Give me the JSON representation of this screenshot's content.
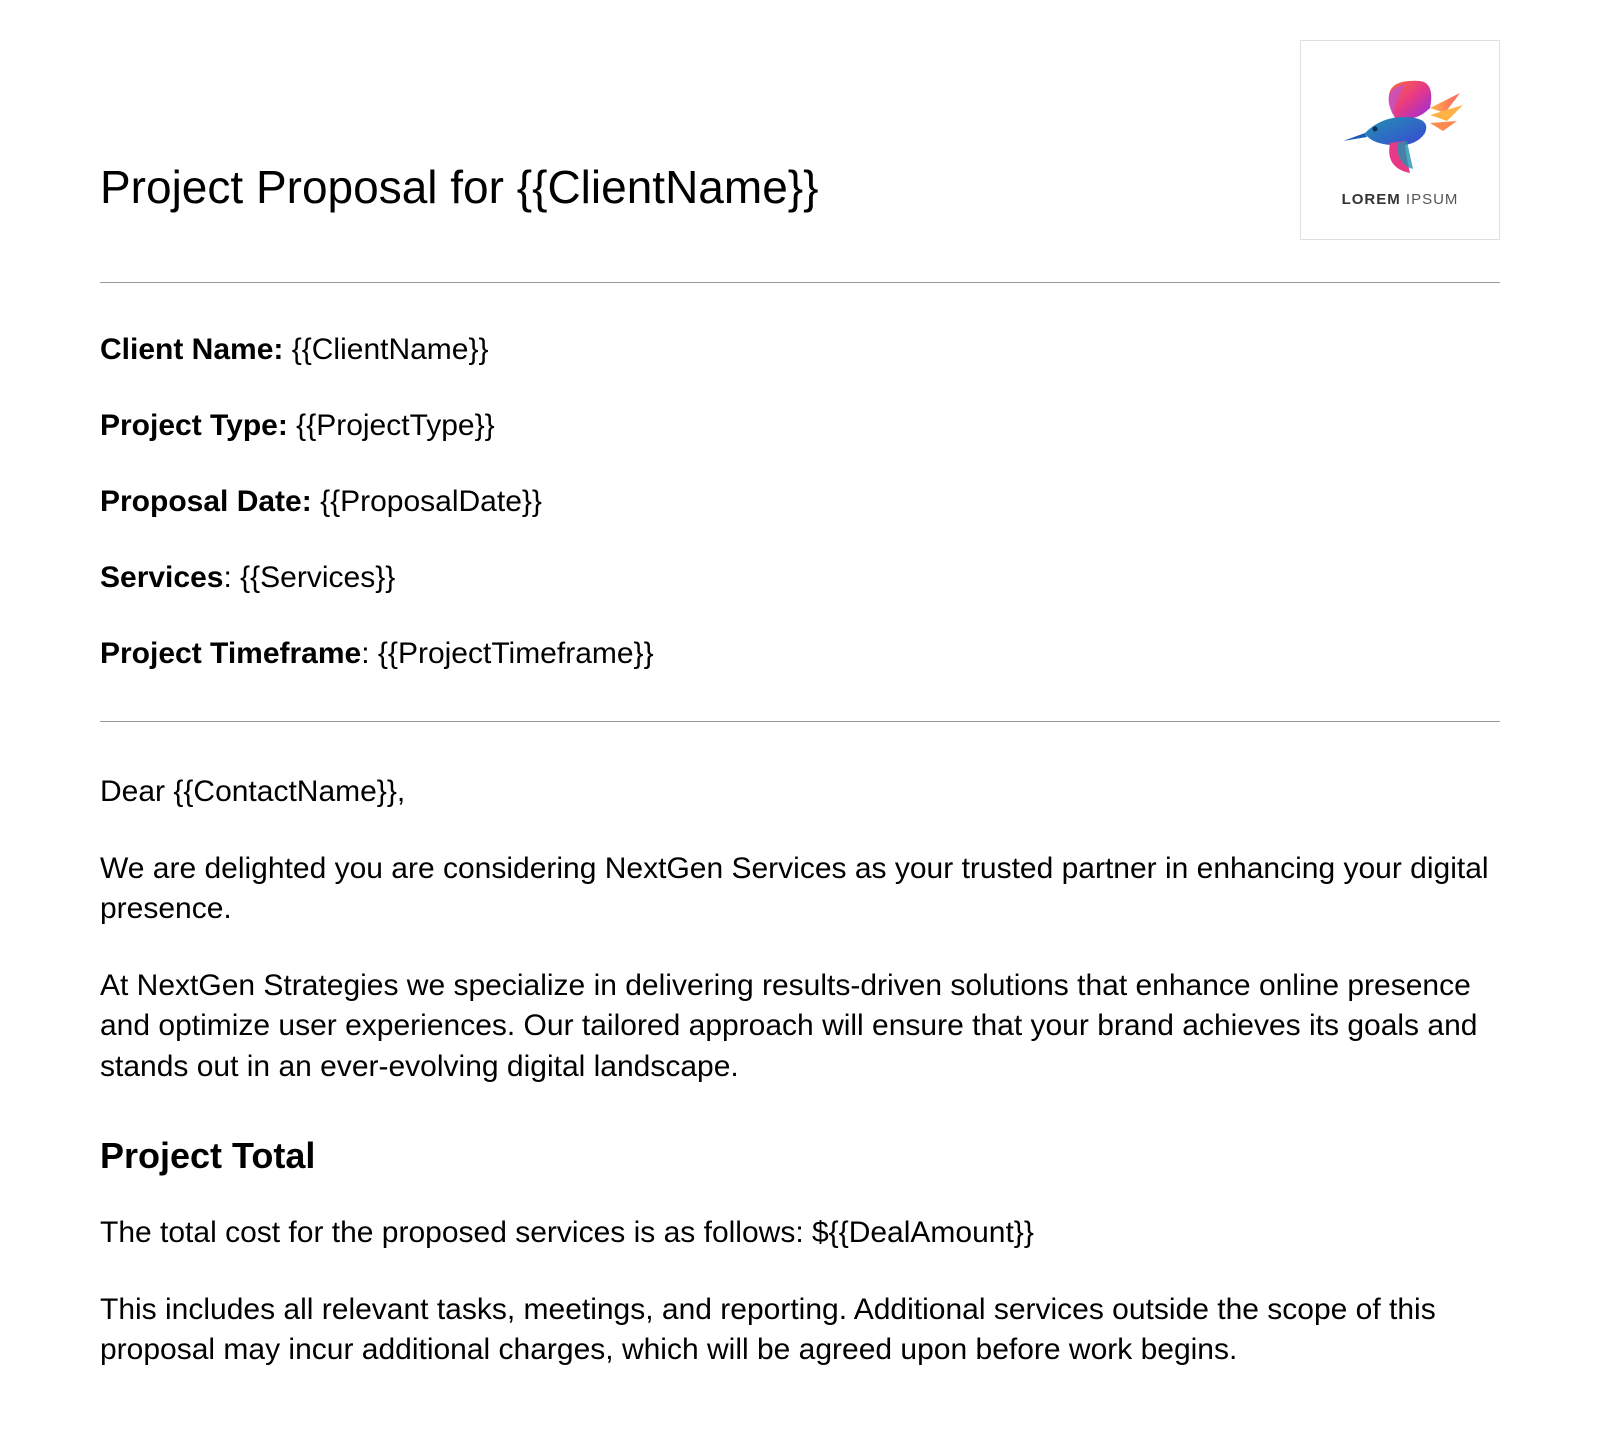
{
  "header": {
    "title": "Project Proposal for {{ClientName}}",
    "logo_text_bold": "LOREM",
    "logo_text_light": " IPSUM"
  },
  "fields": {
    "client_name_label": "Client Name: ",
    "client_name_value": "{{ClientName}}",
    "project_type_label": "Project Type: ",
    "project_type_value": "{{ProjectType}}",
    "proposal_date_label": "Proposal Date: ",
    "proposal_date_value": "{{ProposalDate}}",
    "services_label": "Services",
    "services_sep": ": ",
    "services_value": "{{Services}}",
    "timeframe_label": "Project Timeframe",
    "timeframe_sep": ": ",
    "timeframe_value": "{{ProjectTimeframe}}"
  },
  "body": {
    "greeting": "Dear {{ContactName}},",
    "para1": "We are delighted you are considering NextGen Services as your trusted partner in enhancing your digital presence.",
    "para2": "At NextGen Strategies we specialize in delivering results-driven solutions that enhance online presence and optimize user experiences. Our tailored approach will ensure that your brand achieves its goals and stands out in an ever-evolving digital landscape.",
    "section_heading": "Project Total",
    "total_line": "The total cost for the proposed services is as follows: ${{DealAmount}}",
    "scope_line": "This includes all relevant tasks, meetings, and reporting. Additional services outside the scope of this proposal may incur additional charges, which will be agreed upon before work begins."
  }
}
